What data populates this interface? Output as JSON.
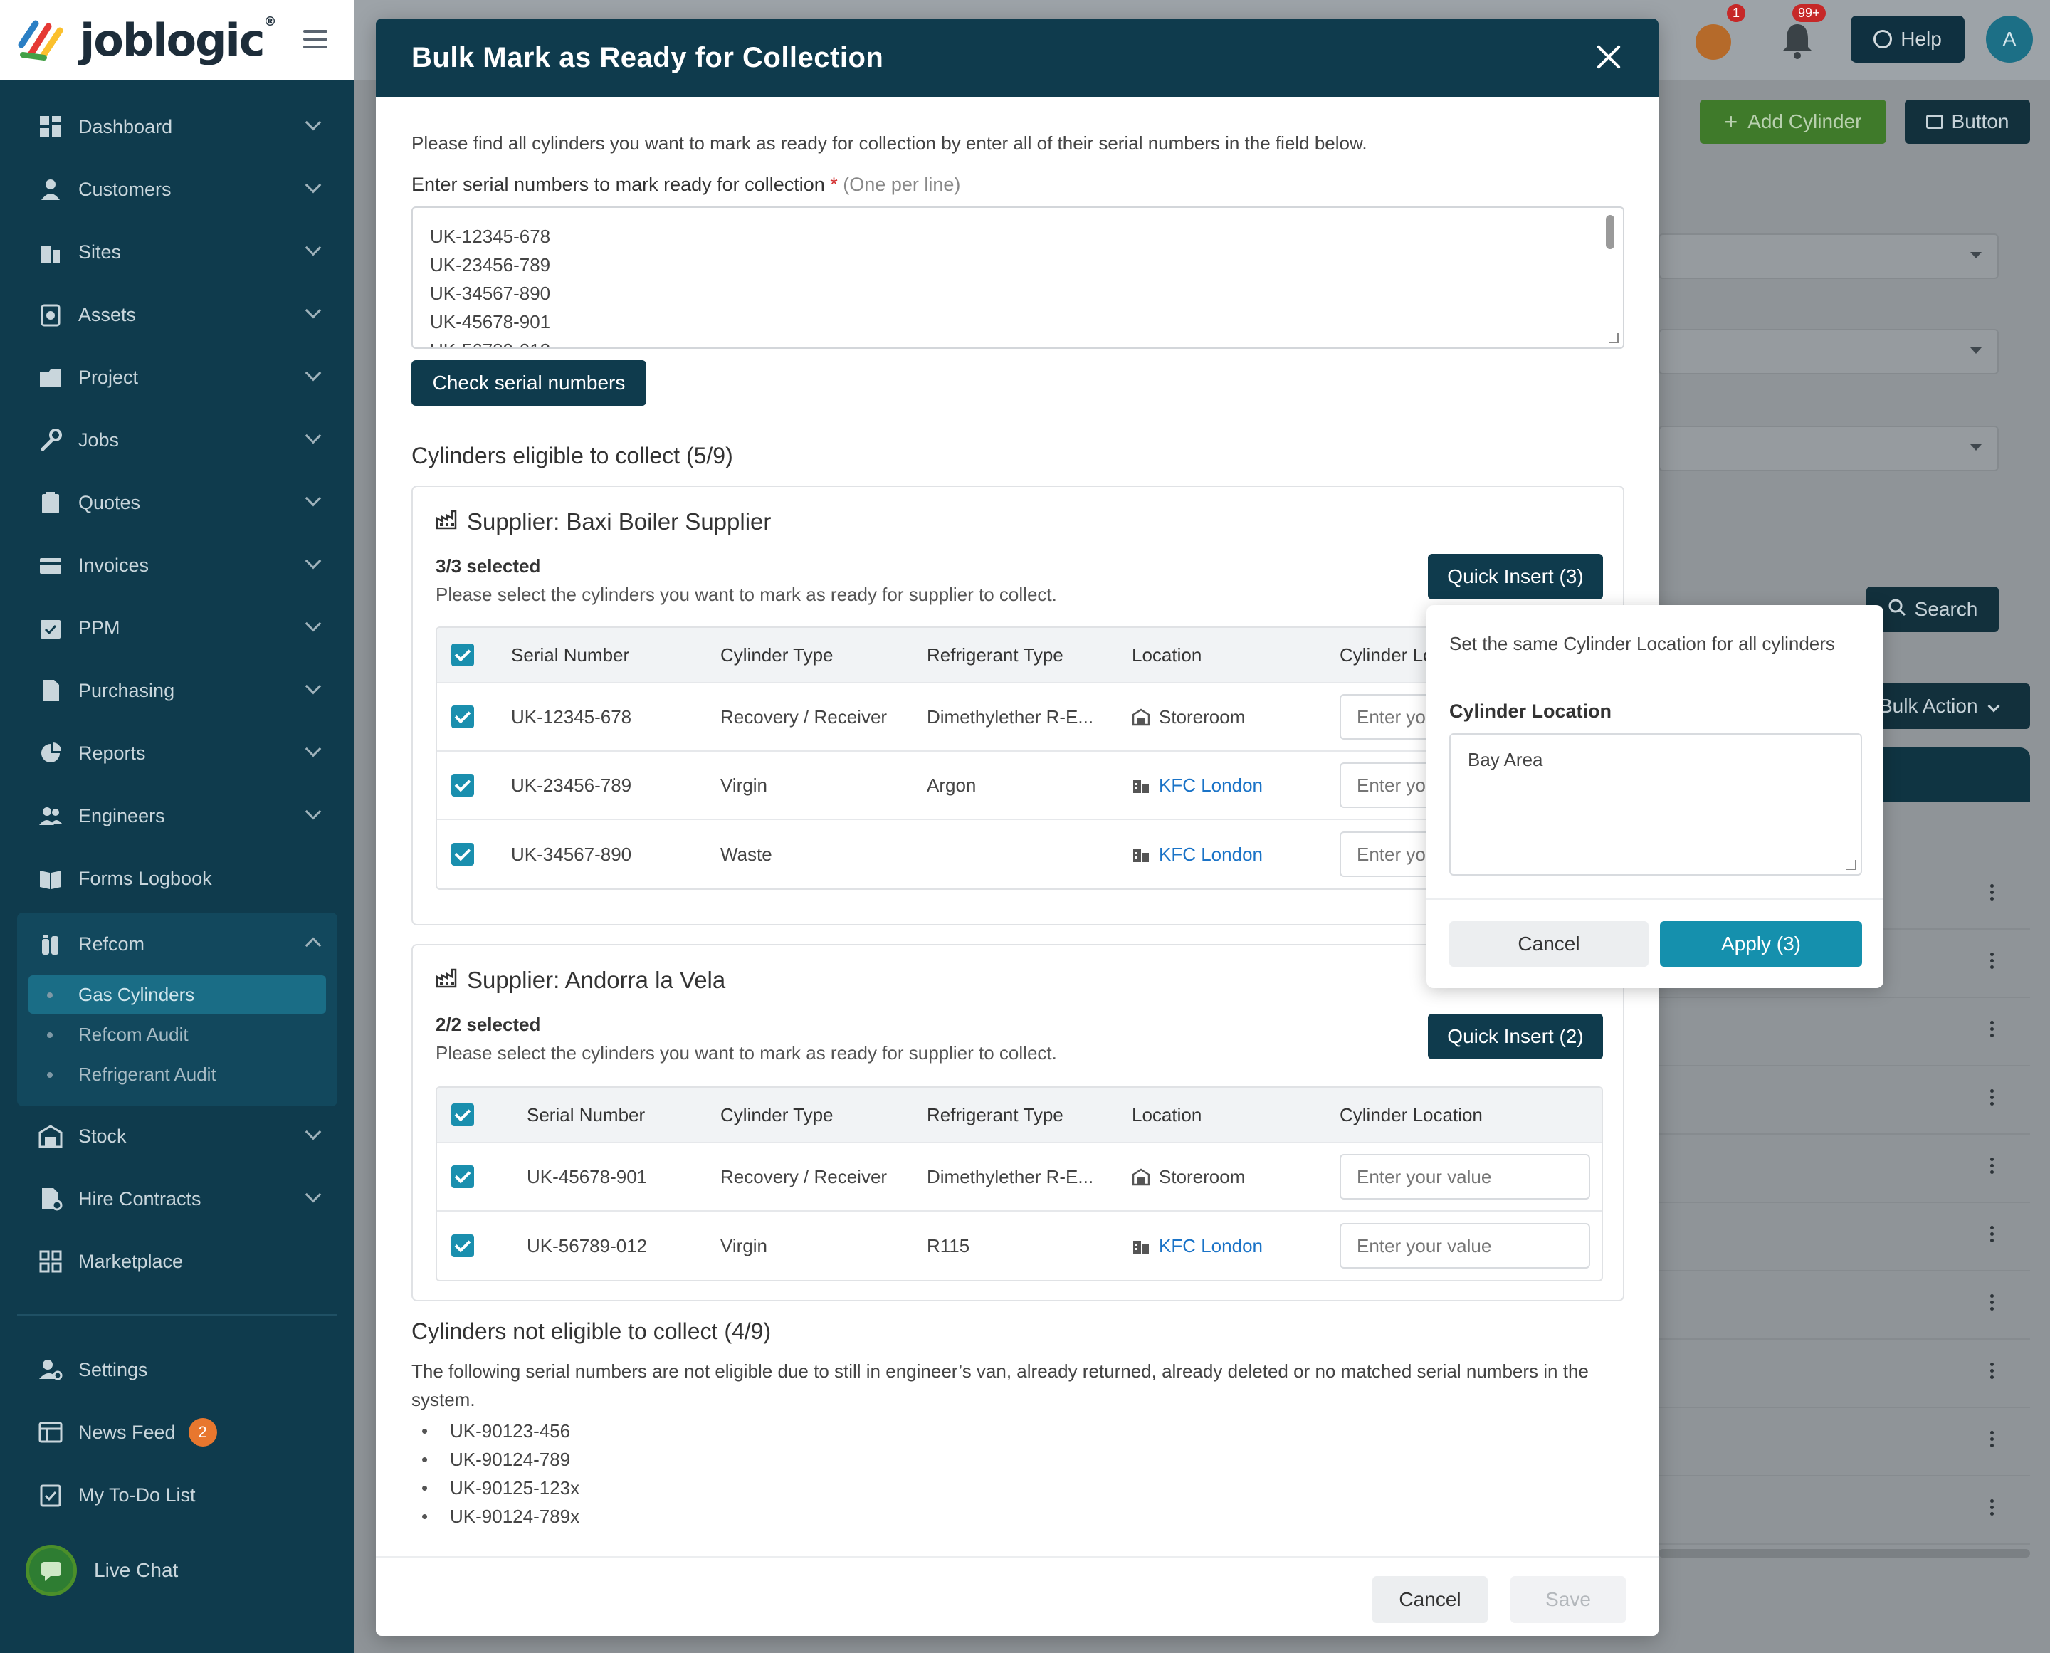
{
  "brand": {
    "name": "joblogic",
    "reg": "®"
  },
  "sidebar": {
    "items": [
      {
        "label": "Dashboard",
        "icon": "dashboard-icon"
      },
      {
        "label": "Customers",
        "icon": "person-icon"
      },
      {
        "label": "Sites",
        "icon": "building-icon"
      },
      {
        "label": "Assets",
        "icon": "asset-icon"
      },
      {
        "label": "Project",
        "icon": "project-icon"
      },
      {
        "label": "Jobs",
        "icon": "wrench-icon"
      },
      {
        "label": "Quotes",
        "icon": "clipboard-icon"
      },
      {
        "label": "Invoices",
        "icon": "card-icon"
      },
      {
        "label": "PPM",
        "icon": "calendar-check-icon"
      },
      {
        "label": "Purchasing",
        "icon": "document-icon"
      },
      {
        "label": "Reports",
        "icon": "pie-chart-icon"
      },
      {
        "label": "Engineers",
        "icon": "people-icon"
      },
      {
        "label": "Forms Logbook",
        "icon": "book-icon"
      },
      {
        "label": "Refcom",
        "icon": "cylinder-icon"
      }
    ],
    "refcom_sub": [
      "Gas Cylinders",
      "Refcom Audit",
      "Refrigerant Audit"
    ],
    "after_items": [
      {
        "label": "Stock",
        "icon": "warehouse-icon"
      },
      {
        "label": "Hire Contracts",
        "icon": "contract-icon"
      },
      {
        "label": "Marketplace",
        "icon": "grid-icon"
      }
    ],
    "bottom": {
      "settings": "Settings",
      "news_feed": "News Feed",
      "news_badge": "2",
      "todo": "My To-Do List",
      "live_chat": "Live Chat"
    }
  },
  "header": {
    "help": "Help",
    "avatar": "A",
    "badge_q": "1",
    "badge_bell": "99+"
  },
  "background": {
    "add_cylinder": "Add Cylinder",
    "button": "Button",
    "search": "Search",
    "bulk_action": "Bulk Action"
  },
  "modal": {
    "title": "Bulk Mark as Ready for Collection",
    "intro": "Please find all cylinders you want to mark as ready for collection by enter all of their serial numbers in the field below.",
    "field_label": "Enter serial numbers to mark ready for collection",
    "required_mark": "*",
    "field_hint": "(One per line)",
    "serials": [
      "UK-12345-678",
      "UK-23456-789",
      "UK-34567-890",
      "UK-45678-901",
      "UK-56789-012"
    ],
    "check_button": "Check serial numbers",
    "eligible_title": "Cylinders eligible to collect (5/9)",
    "columns": [
      "Serial Number",
      "Cylinder Type",
      "Refrigerant Type",
      "Location",
      "Cylinder Location"
    ],
    "suppliers": [
      {
        "title": "Supplier: Baxi Boiler Supplier",
        "selected": "3/3 selected",
        "desc": "Please select the cylinders you want to mark as ready for supplier to collect.",
        "quick_insert": "Quick Insert (3)",
        "rows": [
          {
            "serial": "UK-12345-678",
            "type": "Recovery / Receiver",
            "refrigerant": "Dimethylether R-E...",
            "location": "Storeroom",
            "placeholder": "Enter your value"
          },
          {
            "serial": "UK-23456-789",
            "type": "Virgin",
            "refrigerant": "Argon",
            "location": "KFC London",
            "placeholder": "Enter your value"
          },
          {
            "serial": "UK-34567-890",
            "type": "Waste",
            "refrigerant": "",
            "location": "KFC London",
            "placeholder": "Enter your value"
          }
        ]
      },
      {
        "title": "Supplier: Andorra la Vela",
        "selected": "2/2 selected",
        "desc": "Please select the cylinders you want to mark as ready for supplier to collect.",
        "quick_insert": "Quick Insert (2)",
        "rows": [
          {
            "serial": "UK-45678-901",
            "type": "Recovery / Receiver",
            "refrigerant": "Dimethylether R-E...",
            "location": "Storeroom",
            "placeholder": "Enter your value"
          },
          {
            "serial": "UK-56789-012",
            "type": "Virgin",
            "refrigerant": "R115",
            "location": "KFC London",
            "placeholder": "Enter your value"
          }
        ]
      }
    ],
    "not_eligible_title": "Cylinders not eligible to collect (4/9)",
    "not_eligible_desc": "The following serial numbers are not eligible due to still in engineer’s van, already returned, already deleted or no matched serial numbers in the system.",
    "not_eligible_list": [
      "UK-90123-456",
      "UK-90124-789",
      "UK-90125-123x",
      "UK-90124-789x"
    ],
    "cancel": "Cancel",
    "save": "Save"
  },
  "popover": {
    "desc": "Set the same Cylinder Location for all cylinders",
    "label": "Cylinder Location",
    "value": "Bay Area",
    "cancel": "Cancel",
    "apply": "Apply (3)"
  },
  "colors": {
    "navy": "#0f3b4d",
    "teal": "#1590ad",
    "link": "#1a73c7",
    "green": "#3f7a2a"
  }
}
